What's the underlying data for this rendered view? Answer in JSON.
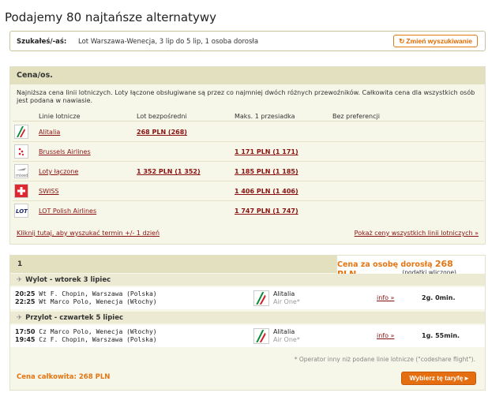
{
  "title": "Podajemy 80 najtańsze alternatywy",
  "search": {
    "label": "Szukałeś/-aś:",
    "text": "Lot Warszawa-Wenecja, 3 lip do 5 lip, 1 osoba dorosła",
    "change_button": "Zmień wyszukiwanie"
  },
  "price_panel": {
    "header": "Cena/os.",
    "note": "Najniższa cena linii lotniczych. Loty łączone obsługiwane są przez co najmniej dwóch różnych przewoźników. Całkowita cena dla wszystkich osób jest podana w nawiasie.",
    "columns": [
      "Linie lotnicze",
      "Lot bezpośredni",
      "Maks. 1 przesiadka",
      "Bez preferencji"
    ],
    "rows": [
      {
        "airline": "Alitalia",
        "logo": "alitalia-logo",
        "direct": "268 PLN (268)",
        "one_stop": ""
      },
      {
        "airline": "Brussels Airlines",
        "logo": "brussels-airlines-logo",
        "direct": "",
        "one_stop": "1 171 PLN (1 171)"
      },
      {
        "airline": "Loty łączone",
        "logo": "mixed-airlines-logo",
        "logo_text": "mixed",
        "direct": "1 352 PLN (1 352)",
        "one_stop": "1 185 PLN (1 185)"
      },
      {
        "airline": "SWISS",
        "logo": "swiss-logo",
        "direct": "",
        "one_stop": "1 406 PLN (1 406)"
      },
      {
        "airline": "LOT Polish Airlines",
        "logo": "lot-logo",
        "logo_text": "LOT",
        "direct": "",
        "one_stop": "1 747 PLN (1 747)"
      }
    ],
    "footer_left": "Kliknij tutaj, aby wyszukać termin +/- 1 dzień",
    "footer_right": "Pokaż ceny wszystkich linii lotniczych »"
  },
  "result": {
    "number": "1",
    "fare_title": "Cena za osobę dorosłą",
    "fare_amount": "268 PLN",
    "fare_sub": "(podatki wliczone)",
    "outbound": {
      "header": "Wylot - wtorek 3 lipiec",
      "dep_time": "20:25",
      "dep_day": "Wt",
      "dep_airport": "F. Chopin, Warszawa (Polska)",
      "arr_time": "22:25",
      "arr_day": "Wt",
      "arr_airport": "Marco Polo, Wenecja (Włochy)",
      "carrier": "Alitalia",
      "operator": "Air One*",
      "info": "info »",
      "duration": "2g. 0min."
    },
    "inbound": {
      "header": "Przylot - czwartek 5 lipiec",
      "dep_time": "17:50",
      "dep_day": "Cz",
      "dep_airport": "Marco Polo, Wenecja (Włochy)",
      "arr_time": "19:45",
      "arr_day": "Cz",
      "arr_airport": "F. Chopin, Warszawa (Polska)",
      "carrier": "Alitalia",
      "operator": "Air One*",
      "info": "info »",
      "duration": "1g. 55min."
    },
    "operator_note": "* Operator inny niż podane linie lotnicze (\"codeshare flight\").",
    "total_label": "Cena całkowita:",
    "total_value": "268 PLN",
    "select_button": "Wybierz tę taryfę"
  },
  "colors": {
    "accent": "#e57512",
    "link": "#8b1111",
    "panel": "#f6f6e9",
    "panel_header": "#e2e0bf"
  }
}
